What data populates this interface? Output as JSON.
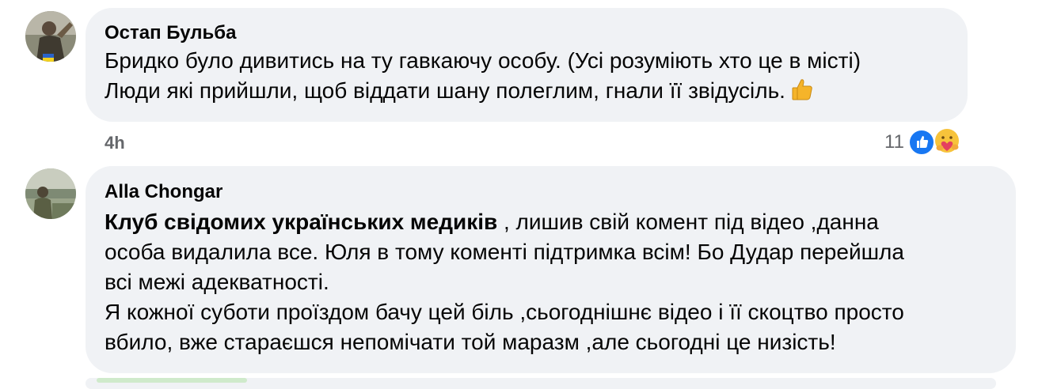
{
  "comments": [
    {
      "author": "Остап Бульба",
      "lines": [
        "Бридко було дивитись на ту гавкаючу особу. (Усі розуміють хто це в місті)",
        "Люди які прийшли, щоб віддати шану полеглим, гнали її звідусіль."
      ],
      "trailing_emoji": "thumbs-up",
      "time": "4h",
      "reaction_count": "11",
      "reactions": [
        "like-icon",
        "care-icon"
      ]
    },
    {
      "author": "Alla Chongar",
      "mention": "Клуб свідомих українських медиків",
      "lines": [
        " , лишив свій комент під відео ,данна",
        "особа видалила все. Юля в тому коменті підтримка всім! Бо Дудар перейшла",
        "всі межі адекватності.",
        "Я кожної суботи проїздом бачу цей біль ,сьогоднішнє відео і її скоцтво просто",
        "вбило, вже стараєшся непомічати той маразм ,але сьогодні це низість!"
      ]
    }
  ],
  "colors": {
    "bubble": "#f0f2f5",
    "meta_text": "#65676b",
    "like_blue": "#1877f2"
  }
}
